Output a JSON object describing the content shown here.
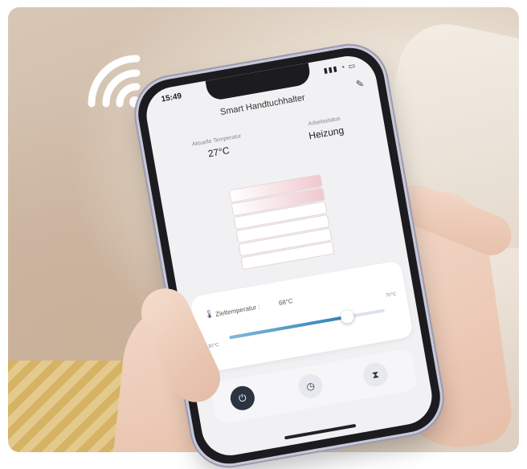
{
  "status": {
    "time": "15:49",
    "icons": "▮▮▮ ◔ ▭"
  },
  "header": {
    "title": "Smart Handtuchhalter",
    "edit_icon": "pencil-icon"
  },
  "current_temperature": {
    "label": "Aktuelle Temperatur",
    "value": "27°C"
  },
  "operating_mode": {
    "label": "Arbeitsstatus",
    "value": "Heizung"
  },
  "target": {
    "label": "Zieltemperatur :",
    "value": "68°C",
    "min": "30°C",
    "max": "70°C",
    "level": 0.76
  },
  "controls": [
    {
      "name": "power",
      "icon": "power-icon"
    },
    {
      "name": "timer",
      "icon": "clock-icon"
    },
    {
      "name": "hourglass",
      "icon": "hourglass-icon"
    }
  ],
  "colors": {
    "accent": "#2f80b8",
    "power_button": "#2b3440",
    "rack_warm": "#efc9cf"
  }
}
